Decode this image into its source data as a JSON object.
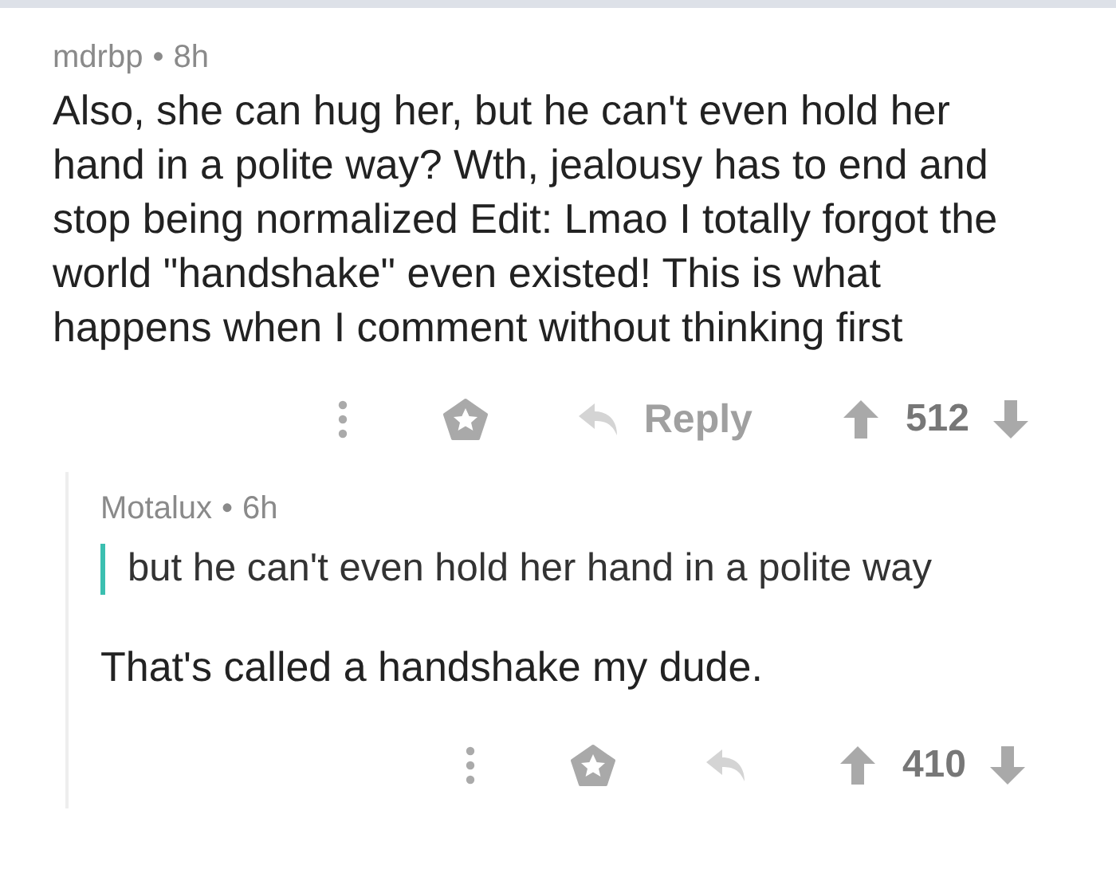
{
  "comments": [
    {
      "author": "mdrbp",
      "separator": "•",
      "age": "8h",
      "body": [
        {
          "kind": "paragraph",
          "text": "Also, she can hug her, but he can't even hold her hand in a polite way? Wth, jealousy has to end and stop being normalized Edit: Lmao I totally forgot the world \"handshake\" even existed! This is what happens when I comment without thinking first"
        }
      ],
      "reply_label": "Reply",
      "score": "512",
      "replies": [
        {
          "author": "Motalux",
          "separator": "•",
          "age": "6h",
          "body": [
            {
              "kind": "quote",
              "text": "but he can't even hold her hand in a polite way"
            },
            {
              "kind": "paragraph",
              "text": "That's called a handshake my dude."
            }
          ],
          "score": "410"
        }
      ]
    }
  ]
}
